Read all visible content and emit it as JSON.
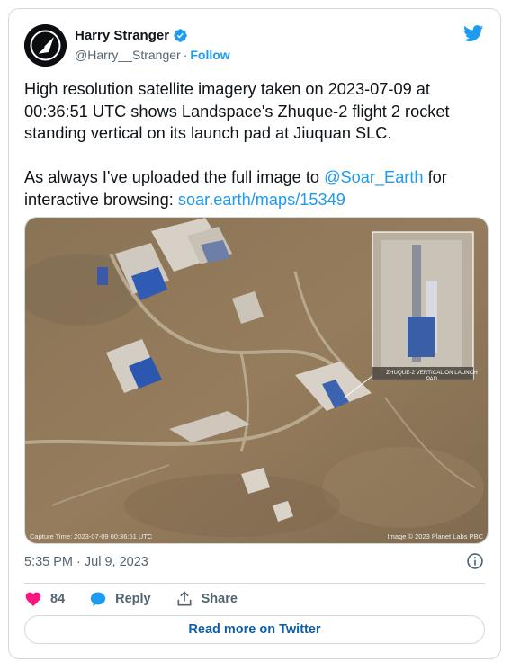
{
  "author": {
    "name": "Harry Stranger",
    "handle": "@Harry__Stranger",
    "separator": "·",
    "follow_label": "Follow",
    "verified_icon": "verified-badge-icon",
    "avatar_icon": "rocket-logo-icon"
  },
  "tweet": {
    "line1": "High resolution satellite imagery taken on 2023-07-09 at 00:36:51 UTC shows Landspace's Zhuque-2 flight 2 rocket standing vertical on its launch pad at Jiuquan SLC.",
    "line2_prefix": "As always I've uploaded the full image to ",
    "mention": "@Soar_Earth",
    "line2_mid": " for interactive browsing: ",
    "link": "soar.earth/maps/15349"
  },
  "media": {
    "capture_text": "Capture Time: 2023-07-09 00:36:51 UTC",
    "copyright_text": "Image © 2023 Planet Labs PBC",
    "inset_label": "ZHUQUE-2 VERTICAL ON LAUNCH PAD"
  },
  "meta": {
    "timestamp": "5:35 PM · Jul 9, 2023"
  },
  "actions": {
    "likes": "84",
    "reply_label": "Reply",
    "share_label": "Share"
  },
  "footer": {
    "read_more_label": "Read more on Twitter"
  },
  "colors": {
    "link": "#1d9bf0",
    "like": "#f91880",
    "text": "#0f1419",
    "secondary": "#536471"
  }
}
